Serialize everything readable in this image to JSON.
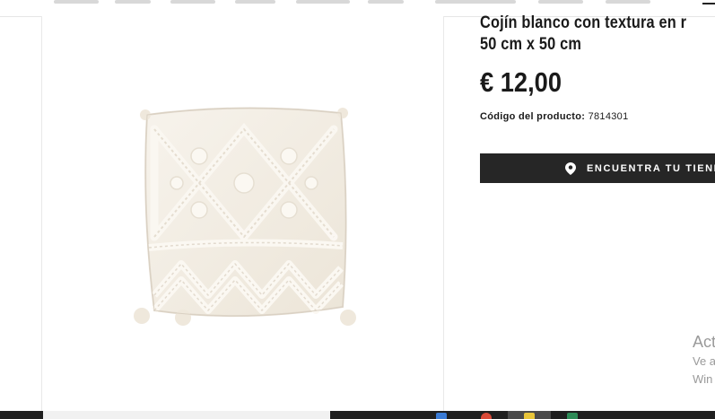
{
  "product": {
    "title_line1": "Cojín blanco con textura en r",
    "title_line2": "50 cm x 50 cm",
    "price": "€ 12,00",
    "code_label": "Código del producto:",
    "code_value": "7814301",
    "store_button_label": "ENCUENTRA TU TIENDA",
    "image_icon": "cushion-product-image"
  },
  "watermark": {
    "title": "Act",
    "line1": "Ve a",
    "line2": "Win"
  },
  "colors": {
    "button_bg": "#262626",
    "text": "#1a1a1a",
    "cushion": "#f4efe6",
    "taskbar": "#1f1f1f"
  },
  "icons": {
    "store_pin": "location-pin-icon",
    "menu": "menu-icon"
  }
}
